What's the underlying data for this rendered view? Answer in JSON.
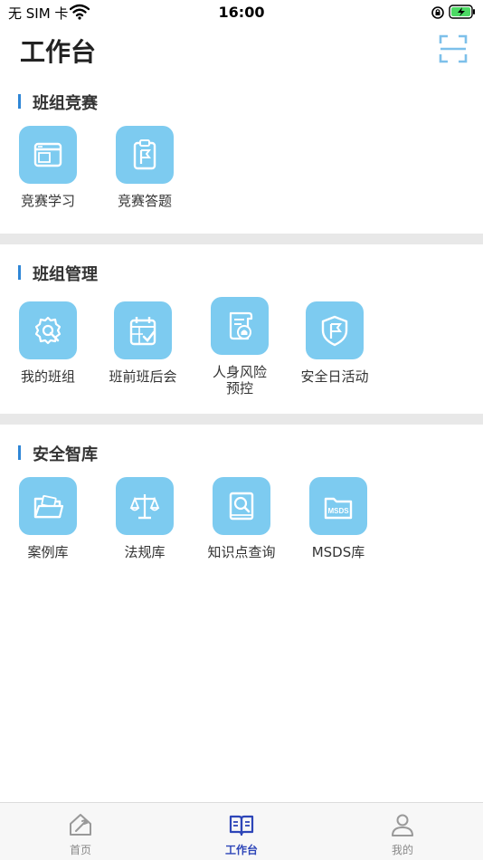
{
  "status_bar": {
    "carrier": "无 SIM 卡",
    "time": "16:00"
  },
  "header": {
    "title": "工作台"
  },
  "sections": [
    {
      "title": "班组竞赛",
      "items": [
        {
          "label": "竞赛学习",
          "icon": "window-icon"
        },
        {
          "label": "竞赛答题",
          "icon": "clipboard-flag-icon"
        }
      ]
    },
    {
      "title": "班组管理",
      "items": [
        {
          "label": "我的班组",
          "icon": "gear-wrench-icon"
        },
        {
          "label": "班前班后会",
          "icon": "calendar-check-icon"
        },
        {
          "label": "人身风险\n预控",
          "icon": "alarm-scroll-icon"
        },
        {
          "label": "安全日活动",
          "icon": "shield-flag-icon"
        }
      ]
    },
    {
      "title": "安全智库",
      "items": [
        {
          "label": "案例库",
          "icon": "folder-icon"
        },
        {
          "label": "法规库",
          "icon": "scales-icon"
        },
        {
          "label": "知识点查询",
          "icon": "book-search-icon"
        },
        {
          "label": "MSDS库",
          "icon": "msds-icon"
        }
      ]
    }
  ],
  "msds_icon_text": "MSDS",
  "tab_bar": [
    {
      "label": "首页",
      "icon": "home-icon",
      "active": false
    },
    {
      "label": "工作台",
      "icon": "book-icon",
      "active": true
    },
    {
      "label": "我的",
      "icon": "person-icon",
      "active": false
    }
  ],
  "colors": {
    "accent": "#2f86d6",
    "tile": "#7dcbf0",
    "tab_active": "#2d45b8"
  }
}
